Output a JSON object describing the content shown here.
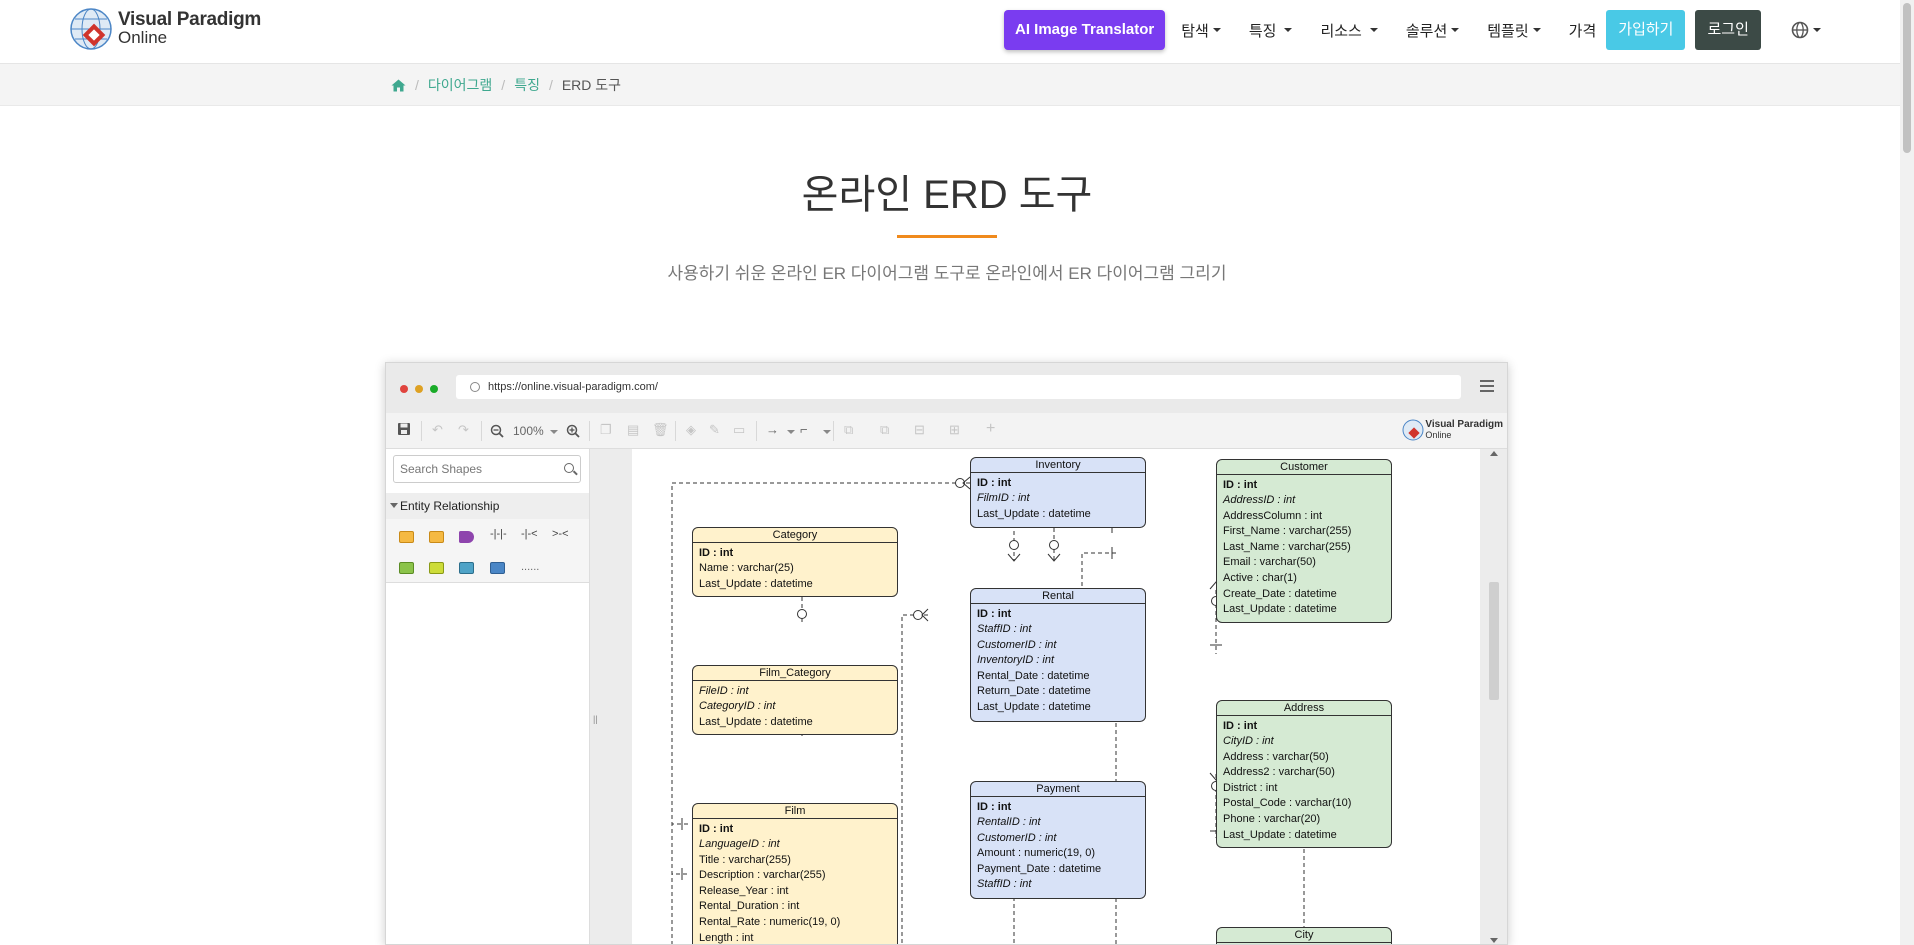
{
  "nav": {
    "logo_line1": "Visual Paradigm",
    "logo_line2": "Online",
    "ai_button": "AI Image Translator",
    "items": [
      {
        "label": "탐색",
        "caret": true
      },
      {
        "label": "특징",
        "caret": true
      },
      {
        "label": "리소스",
        "caret": true
      },
      {
        "label": "솔루션",
        "caret": true
      },
      {
        "label": "템플릿",
        "caret": true
      },
      {
        "label": "가격",
        "caret": false
      }
    ],
    "signup": "가입하기",
    "login": "로그인",
    "language_icon": "globe-icon"
  },
  "breadcrumb": {
    "home_icon": "home-icon",
    "items": [
      "다이어그램",
      "특징"
    ],
    "current": "ERD 도구"
  },
  "hero": {
    "title": "온라인 ERD 도구",
    "subtitle": "사용하기 쉬운 온라인 ER 다이어그램 도구로 온라인에서 ER 다이어그램 그리기",
    "accent_color": "#f08a1c"
  },
  "mock": {
    "url": "https://online.visual-paradigm.com/",
    "zoom": "100%",
    "brand_line1": "Visual Paradigm",
    "brand_line2": "Online",
    "search_placeholder": "Search Shapes",
    "palette_title": "Entity Relationship"
  },
  "entities": {
    "inventory": {
      "title": "Inventory",
      "fields": [
        "ID : int",
        "FilmID : int",
        "Last_Update : datetime"
      ]
    },
    "customer": {
      "title": "Customer",
      "fields": [
        "ID : int",
        "AddressID : int",
        "AddressColumn : int",
        "First_Name : varchar(255)",
        "Last_Name : varchar(255)",
        "Email : varchar(50)",
        "Active : char(1)",
        "Create_Date : datetime",
        "Last_Update : datetime"
      ]
    },
    "category": {
      "title": "Category",
      "fields": [
        "ID : int",
        "Name : varchar(25)",
        "Last_Update : datetime"
      ]
    },
    "rental": {
      "title": "Rental",
      "fields": [
        "ID : int",
        "StaffID : int",
        "CustomerID : int",
        "InventoryID : int",
        "Rental_Date : datetime",
        "Return_Date : datetime",
        "Last_Update : datetime"
      ]
    },
    "film_category": {
      "title": "Film_Category",
      "fields": [
        "FileID : int",
        "CategoryID : int",
        "Last_Update : datetime"
      ]
    },
    "address": {
      "title": "Address",
      "fields": [
        "ID : int",
        "CityID : int",
        "Address : varchar(50)",
        "Address2 : varchar(50)",
        "District : int",
        "Postal_Code : varchar(10)",
        "Phone : varchar(20)",
        "Last_Update : datetime"
      ]
    },
    "payment": {
      "title": "Payment",
      "fields": [
        "ID : int",
        "RentalID : int",
        "CustomerID : int",
        "Amount : numeric(19, 0)",
        "Payment_Date : datetime",
        "StaffID : int"
      ]
    },
    "film": {
      "title": "Film",
      "fields": [
        "ID : int",
        "LanguageID : int",
        "Title : varchar(255)",
        "Description : varchar(255)",
        "Release_Year : int",
        "Rental_Duration : int",
        "Rental_Rate : numeric(19, 0)",
        "Length : int"
      ]
    },
    "city": {
      "title": "City",
      "fields": []
    }
  }
}
